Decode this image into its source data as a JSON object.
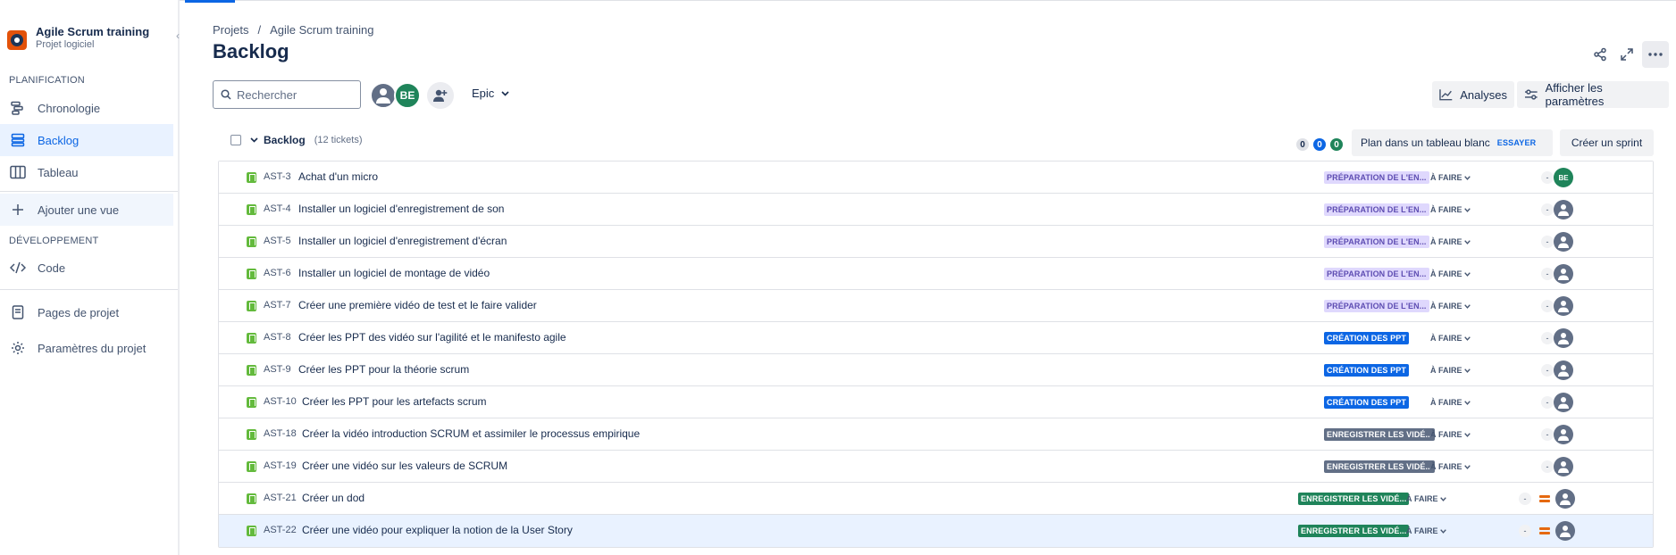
{
  "project": {
    "name": "Agile Scrum training",
    "type": "Projet logiciel"
  },
  "sidebar": {
    "sections": {
      "planning": "PLANIFICATION",
      "development": "DÉVELOPPEMENT"
    },
    "items": {
      "timeline": "Chronologie",
      "backlog": "Backlog",
      "board": "Tableau",
      "add_view": "Ajouter une vue",
      "code": "Code",
      "pages": "Pages de projet",
      "settings": "Paramètres du projet"
    }
  },
  "breadcrumb": {
    "root": "Projets",
    "sep": "/",
    "current": "Agile Scrum training"
  },
  "page_title": "Backlog",
  "toolbar": {
    "search_placeholder": "Rechercher",
    "avatar_initials": "BE",
    "epic_filter": "Epic",
    "analytics": "Analyses",
    "view_settings": "Afficher les paramètres"
  },
  "backlog": {
    "title": "Backlog",
    "count": "(12 tickets)",
    "pills": [
      "0",
      "0",
      "0"
    ],
    "plan_label": "Plan dans un tableau blanc",
    "try_label": "ESSAYER",
    "create_sprint": "Créer un sprint"
  },
  "colors": {
    "accent": "#0c66e4",
    "story": "#63ba3c",
    "epic_purple_bg": "#dfd8fd",
    "epic_blue": "#0c66e4",
    "epic_grey": "#626f86",
    "epic_green": "#1f845a",
    "priority_medium": "#e56910"
  },
  "issues": [
    {
      "key": "AST-3",
      "summary": "Achat d'un micro",
      "epic": "PRÉPARATION DE L'EN...",
      "status": "À FAIRE",
      "estimate": "-",
      "assignee": "BE"
    },
    {
      "key": "AST-4",
      "summary": "Installer un logiciel d'enregistrement de son",
      "epic": "PRÉPARATION DE L'EN...",
      "status": "À FAIRE",
      "estimate": "-",
      "assignee": ""
    },
    {
      "key": "AST-5",
      "summary": "Installer un logiciel d'enregistrement d'écran",
      "epic": "PRÉPARATION DE L'EN...",
      "status": "À FAIRE",
      "estimate": "-",
      "assignee": ""
    },
    {
      "key": "AST-6",
      "summary": "Installer un logiciel de montage de vidéo",
      "epic": "PRÉPARATION DE L'EN...",
      "status": "À FAIRE",
      "estimate": "-",
      "assignee": ""
    },
    {
      "key": "AST-7",
      "summary": "Créer une première vidéo de test et le faire valider",
      "epic": "PRÉPARATION DE L'EN...",
      "status": "À FAIRE",
      "estimate": "-",
      "assignee": ""
    },
    {
      "key": "AST-8",
      "summary": "Créer les PPT des vidéo sur l'agilité et le manifesto agile",
      "epic": "CRÉATION DES PPT",
      "status": "À FAIRE",
      "estimate": "-",
      "assignee": ""
    },
    {
      "key": "AST-9",
      "summary": "Créer les PPT pour la théorie scrum",
      "epic": "CRÉATION DES PPT",
      "status": "À FAIRE",
      "estimate": "-",
      "assignee": ""
    },
    {
      "key": "AST-10",
      "summary": "Créer les PPT pour les artefacts scrum",
      "epic": "CRÉATION DES PPT",
      "status": "À FAIRE",
      "estimate": "-",
      "assignee": ""
    },
    {
      "key": "AST-18",
      "summary": "Créer la vidéo introduction SCRUM et assimiler le processus empirique",
      "epic": "ENREGISTRER LES VIDÉ...",
      "status": "À FAIRE",
      "estimate": "-",
      "assignee": ""
    },
    {
      "key": "AST-19",
      "summary": "Créer une vidéo sur les valeurs de SCRUM",
      "epic": "ENREGISTRER LES VIDÉ...",
      "status": "À FAIRE",
      "estimate": "-",
      "assignee": ""
    },
    {
      "key": "AST-21",
      "summary": "Créer un dod",
      "epic": "ENREGISTRER LES VIDÉ...",
      "status": "À FAIRE",
      "estimate": "-",
      "assignee": ""
    },
    {
      "key": "AST-22",
      "summary": "Créer une vidéo pour expliquer la notion de la User Story",
      "epic": "ENREGISTRER LES VIDÉ...",
      "status": "À FAIRE",
      "estimate": "-",
      "assignee": ""
    }
  ]
}
